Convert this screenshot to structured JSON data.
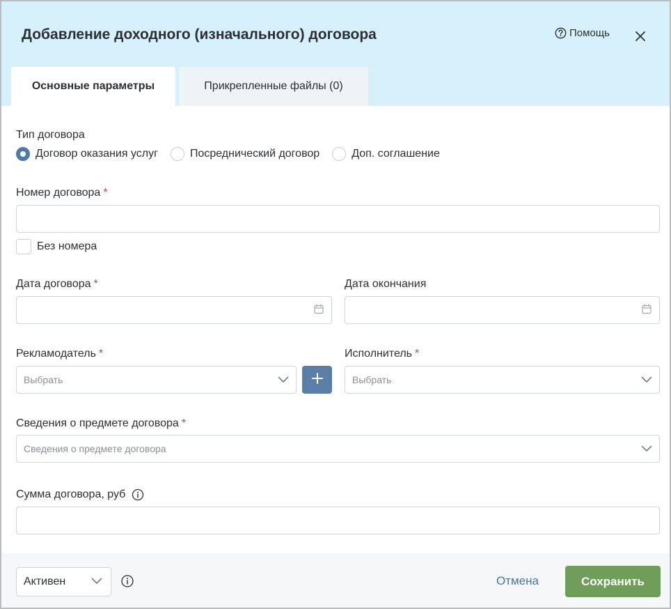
{
  "dialog": {
    "title": "Добавление доходного (изначального) договора",
    "help_label": "Помощь"
  },
  "tabs": [
    {
      "label": "Основные параметры",
      "active": true
    },
    {
      "label": "Прикрепленные файлы (0)",
      "active": false
    }
  ],
  "contract_type": {
    "label": "Тип договора",
    "options": [
      {
        "label": "Договор оказания услуг",
        "selected": true
      },
      {
        "label": "Посреднический договор",
        "selected": false
      },
      {
        "label": "Доп. соглашение",
        "selected": false
      }
    ]
  },
  "contract_number": {
    "label": "Номер договора",
    "required_mark": "*",
    "value": "",
    "no_number_label": "Без номера",
    "no_number_checked": false
  },
  "contract_date": {
    "label": "Дата договора",
    "required_mark": "*",
    "value": ""
  },
  "end_date": {
    "label": "Дата окончания",
    "value": ""
  },
  "advertiser": {
    "label": "Рекламодатель",
    "required_mark": "*",
    "placeholder": "Выбрать"
  },
  "executor": {
    "label": "Исполнитель",
    "required_mark": "*",
    "placeholder": "Выбрать"
  },
  "subject": {
    "label": "Сведения о предмете договора",
    "required_mark": "*",
    "placeholder": "Сведения о предмете договора"
  },
  "amount": {
    "label": "Сумма договора, руб",
    "value": ""
  },
  "footer": {
    "status_value": "Активен",
    "cancel_label": "Отмена",
    "save_label": "Сохранить"
  },
  "colors": {
    "header_bg": "#d6f0fc",
    "accent": "#5b7ea6",
    "save_button": "#6f9e5a",
    "required": "#d0404a",
    "link": "#4a74a4"
  },
  "icons": {
    "help": "question-circle-icon",
    "close": "close-icon",
    "calendar": "calendar-icon",
    "dropdown": "chevron-down-icon",
    "add": "plus-icon",
    "info": "info-circle-icon"
  }
}
